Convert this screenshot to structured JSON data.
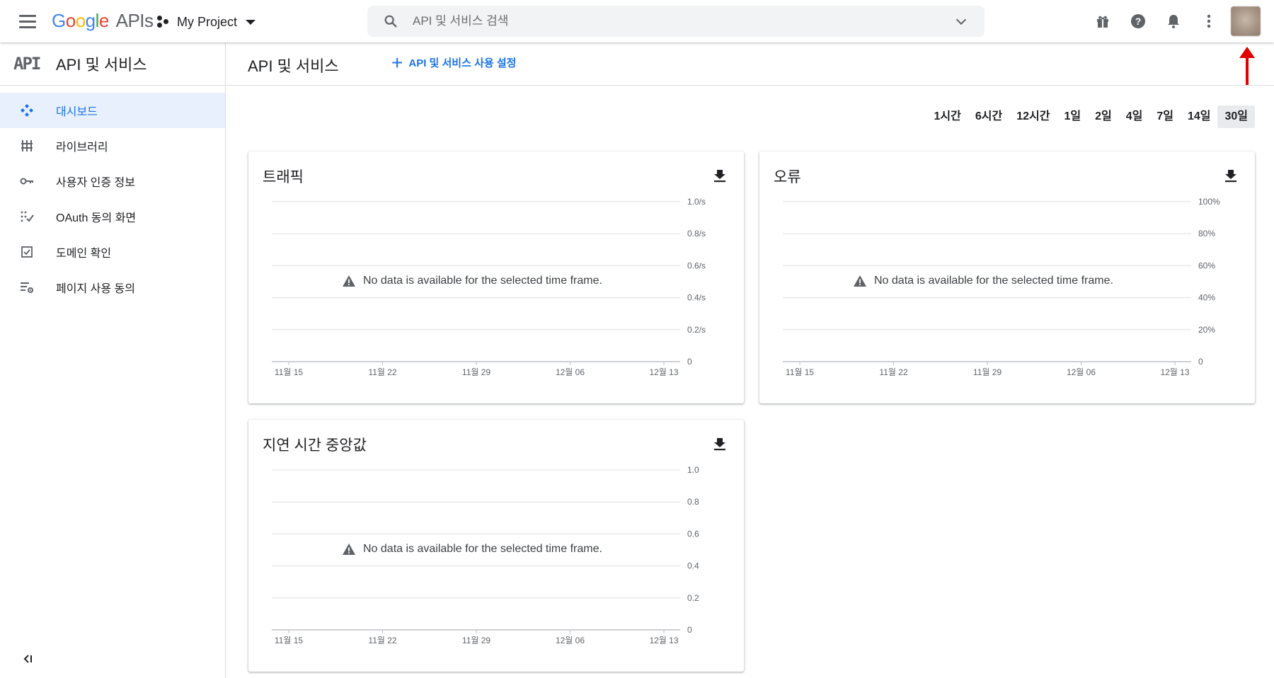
{
  "topbar": {
    "logo_letters": [
      "G",
      "o",
      "o",
      "g",
      "l",
      "e"
    ],
    "logo_suffix": "APIs",
    "project": "My Project",
    "search_placeholder": "API 및 서비스 검색",
    "icons": [
      "menu-icon",
      "gift-icon",
      "help-icon",
      "bell-icon",
      "more-vert-icon",
      "avatar"
    ]
  },
  "sidebar": {
    "logo_text": "API",
    "title": "API 및 서비스",
    "items": [
      {
        "label": "대시보드",
        "icon": "dashboard-icon",
        "active": true
      },
      {
        "label": "라이브러리",
        "icon": "library-icon",
        "active": false
      },
      {
        "label": "사용자 인증 정보",
        "icon": "key-icon",
        "active": false
      },
      {
        "label": "OAuth 동의 화면",
        "icon": "consent-icon",
        "active": false
      },
      {
        "label": "도메인 확인",
        "icon": "checkbox-icon",
        "active": false
      },
      {
        "label": "페이지 사용 동의",
        "icon": "settings-list-icon",
        "active": false
      }
    ],
    "collapse_icon": "collapse-icon"
  },
  "main": {
    "title": "API 및 서비스",
    "enable_label": "API 및 서비스 사용 설정",
    "ranges": [
      "1시간",
      "6시간",
      "12시간",
      "1일",
      "2일",
      "4일",
      "7일",
      "14일",
      "30일"
    ],
    "selected_range": "30일",
    "no_data_text": "No data is available for the selected time frame."
  },
  "colors": {
    "accent": "#1a73e8",
    "active_bg": "#e8f0fe",
    "arrow": "#e00000"
  },
  "chart_data": [
    {
      "type": "line",
      "title": "트래픽",
      "x_ticks": [
        "11월 15",
        "11월 22",
        "11월 29",
        "12월 06",
        "12월 13"
      ],
      "y_ticks": [
        "0",
        "0.2/s",
        "0.4/s",
        "0.6/s",
        "0.8/s",
        "1.0/s"
      ],
      "ylim": [
        0,
        1.0
      ],
      "series": [],
      "grid": true
    },
    {
      "type": "line",
      "title": "오류",
      "x_ticks": [
        "11월 15",
        "11월 22",
        "11월 29",
        "12월 06",
        "12월 13"
      ],
      "y_ticks": [
        "0",
        "20%",
        "40%",
        "60%",
        "80%",
        "100%"
      ],
      "ylim": [
        0,
        100
      ],
      "series": [],
      "grid": true
    },
    {
      "type": "line",
      "title": "지연 시간 중앙값",
      "x_ticks": [
        "11월 15",
        "11월 22",
        "11월 29",
        "12월 06",
        "12월 13"
      ],
      "y_ticks": [
        "0",
        "0.2",
        "0.4",
        "0.6",
        "0.8",
        "1.0"
      ],
      "ylim": [
        0,
        1.0
      ],
      "series": [],
      "grid": true
    }
  ]
}
